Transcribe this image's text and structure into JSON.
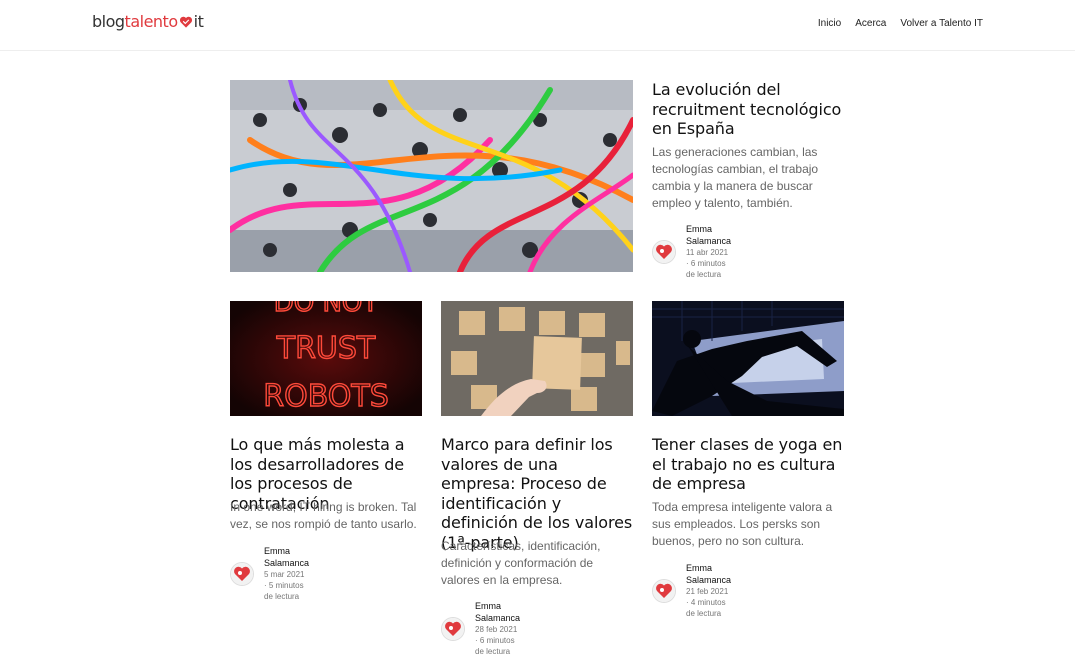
{
  "brand": {
    "part1": "blog",
    "part2": "talento",
    "part3": "it"
  },
  "nav": [
    {
      "label": "Inicio"
    },
    {
      "label": "Acerca"
    },
    {
      "label": "Volver a Talento IT"
    }
  ],
  "posts": [
    {
      "title": "La evolución del recruitment tecnológico en España",
      "excerpt": "Las generaciones cambian, las tecnologías cambian, el trabajo cambia y la manera de buscar empleo y talento, también.",
      "author": "Emma Salamanca",
      "date": "11 abr 2021",
      "read_time": "6 minutos de lectura"
    },
    {
      "title": "Lo que más molesta a los desarrolladores de los procesos de contratación",
      "excerpt": "In one word, IT hiring is broken. Tal vez, se nos rompió de tanto usarlo.",
      "author": "Emma Salamanca",
      "date": "5 mar 2021",
      "read_time": "5 minutos de lectura",
      "image_text": [
        "DO NOT",
        "TRUST",
        "ROBOTS"
      ]
    },
    {
      "title": "Marco para definir los valores de una empresa: Proceso de identificación y definición de los valores (1ª-parte)",
      "excerpt": "Características, identificación, definición y conformación de valores en la empresa.",
      "author": "Emma Salamanca",
      "date": "28 feb 2021",
      "read_time": "6 minutos de lectura"
    },
    {
      "title": "Tener clases de yoga en el trabajo no es cultura de empresa",
      "excerpt": "Toda empresa inteligente valora a sus empleados. Los persks son buenos, pero no son cultura.",
      "author": "Emma Salamanca",
      "date": "21 feb 2021",
      "read_time": "4 minutos de lectura"
    }
  ],
  "meta_separator": "·",
  "colors": {
    "brand_red": "#e03a3e",
    "text": "#111111",
    "muted": "#666666"
  }
}
